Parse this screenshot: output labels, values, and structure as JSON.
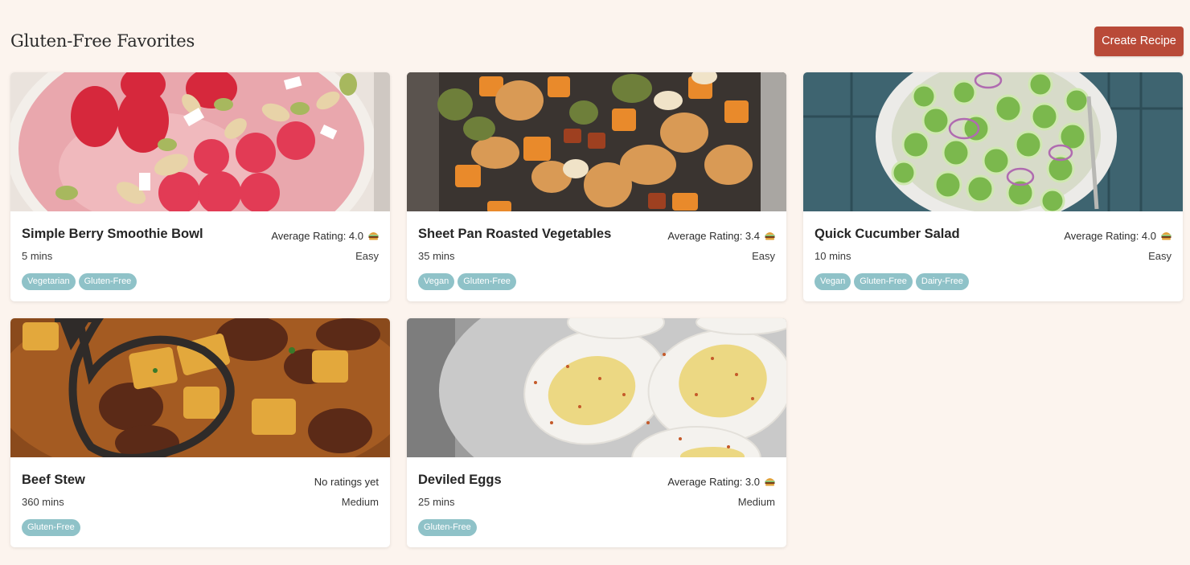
{
  "header": {
    "title": "Gluten-Free Favorites",
    "create_label": "Create Recipe"
  },
  "colors": {
    "background": "#fcf4ee",
    "accent": "#b94a38",
    "tag": "#8fc2c8"
  },
  "rating_icon": "burger-icon",
  "recipes": [
    {
      "title": "Simple Berry Smoothie Bowl",
      "rating": "Average Rating: 4.0",
      "time": "5 mins",
      "difficulty": "Easy",
      "tags": [
        "Vegetarian",
        "Gluten-Free"
      ],
      "image": "berry-smoothie-bowl-photo"
    },
    {
      "title": "Sheet Pan Roasted Vegetables",
      "rating": "Average Rating: 3.4",
      "time": "35 mins",
      "difficulty": "Easy",
      "tags": [
        "Vegan",
        "Gluten-Free"
      ],
      "image": "roasted-vegetables-photo"
    },
    {
      "title": "Quick Cucumber Salad",
      "rating": "Average Rating: 4.0",
      "time": "10 mins",
      "difficulty": "Easy",
      "tags": [
        "Vegan",
        "Gluten-Free",
        "Dairy-Free"
      ],
      "image": "cucumber-salad-photo"
    },
    {
      "title": "Beef Stew",
      "rating": "No ratings yet",
      "time": "360 mins",
      "difficulty": "Medium",
      "tags": [
        "Gluten-Free"
      ],
      "image": "beef-stew-photo"
    },
    {
      "title": "Deviled Eggs",
      "rating": "Average Rating: 3.0",
      "time": "25 mins",
      "difficulty": "Medium",
      "tags": [
        "Gluten-Free"
      ],
      "image": "deviled-eggs-photo"
    }
  ]
}
